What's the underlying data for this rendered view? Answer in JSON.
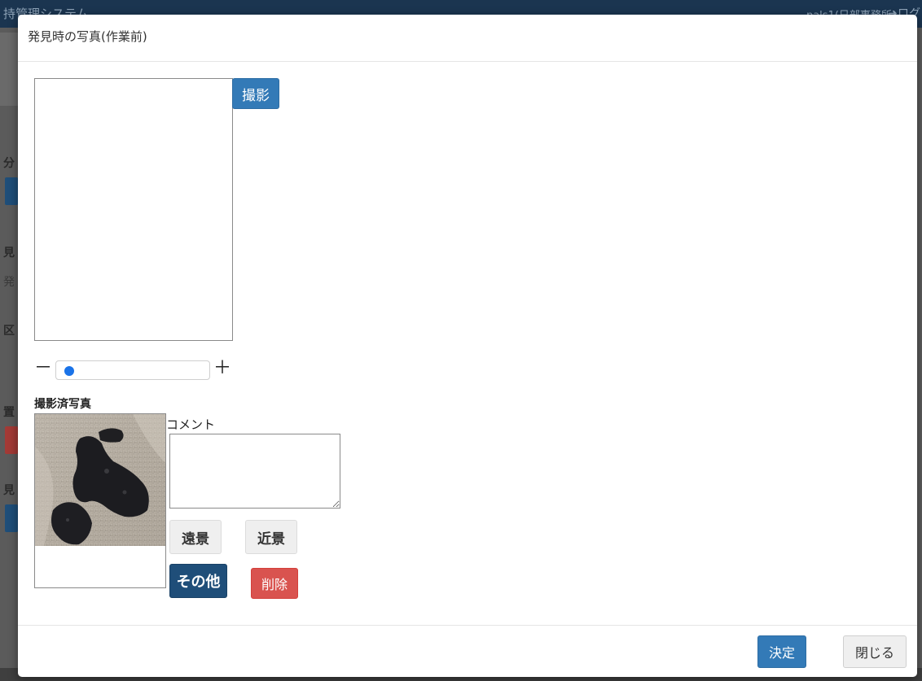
{
  "background": {
    "app_title": "持管理システム",
    "user_label": "pals1(日部事務所)",
    "logout_label": "➜ログ",
    "side_labels": [
      "分",
      "見",
      "発",
      "区",
      "置",
      "見"
    ]
  },
  "modal": {
    "title": "発見時の写真(作業前)",
    "capture_button": "撮影",
    "zoom": {
      "minus": "－",
      "plus": "＋",
      "value": 0.04
    },
    "taken_photos_label": "撮影済写真",
    "comment_label": "コメント",
    "comment_value": "",
    "buttons": {
      "far": "遠景",
      "near": "近景",
      "other": "その他",
      "delete": "削除"
    },
    "footer": {
      "ok": "決定",
      "close": "閉じる"
    }
  },
  "colors": {
    "primary": "#337ab7",
    "dark_primary": "#1f4e79",
    "danger": "#d9534f",
    "light": "#efefef",
    "header_bg": "#1b3550"
  },
  "icons": {
    "zoom_minus": "minus-icon",
    "zoom_plus": "plus-icon"
  }
}
